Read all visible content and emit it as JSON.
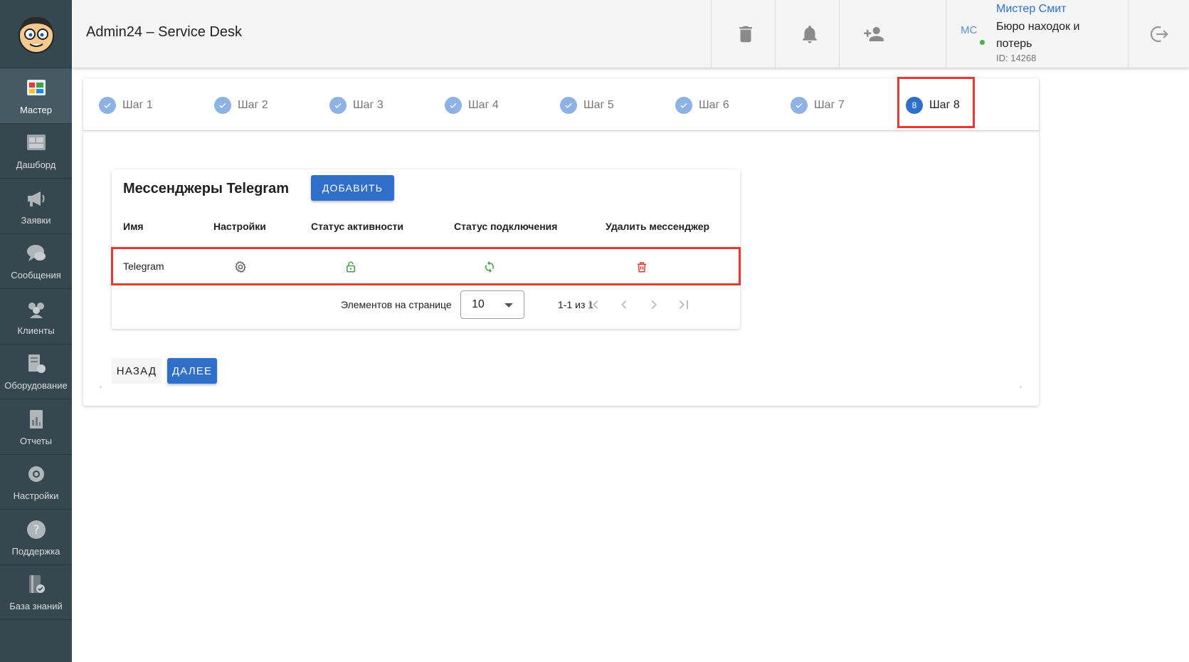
{
  "app": {
    "title": "Admin24 – Service Desk"
  },
  "sidebar": {
    "items": [
      {
        "label": "Мастер",
        "icon": "wizard-icon",
        "active": true
      },
      {
        "label": "Дашборд",
        "icon": "dashboard-icon"
      },
      {
        "label": "Заявки",
        "icon": "megaphone-icon"
      },
      {
        "label": "Сообщения",
        "icon": "chat-icon"
      },
      {
        "label": "Клиенты",
        "icon": "clients-icon"
      },
      {
        "label": "Оборудование",
        "icon": "equipment-icon"
      },
      {
        "label": "Отчеты",
        "icon": "reports-icon"
      },
      {
        "label": "Настройки",
        "icon": "gear-icon"
      },
      {
        "label": "Поддержка",
        "icon": "help-icon"
      },
      {
        "label": "База знаний",
        "icon": "knowledge-base-icon"
      }
    ]
  },
  "header": {
    "user": {
      "initials": "МС",
      "name": "Мистер Смит",
      "org": "Бюро находок и потерь",
      "id": "ID: 14268"
    }
  },
  "steps": [
    {
      "label": "Шаг 1",
      "done": true
    },
    {
      "label": "Шаг 2",
      "done": true
    },
    {
      "label": "Шаг 3",
      "done": true
    },
    {
      "label": "Шаг 4",
      "done": true
    },
    {
      "label": "Шаг 5",
      "done": true
    },
    {
      "label": "Шаг 6",
      "done": true
    },
    {
      "label": "Шаг 7",
      "done": true
    },
    {
      "label": "Шаг 8",
      "number": "8",
      "current": true
    }
  ],
  "messengers": {
    "title": "Мессенджеры Telegram",
    "add_label": "ДОБАВИТЬ",
    "columns": [
      "Имя",
      "Настройки",
      "Статус активности",
      "Статус подключения",
      "Удалить мессенджер"
    ],
    "rows": [
      {
        "name": "Telegram"
      }
    ],
    "pager": {
      "per_page_label": "Элементов на странице",
      "per_page_value": "10",
      "range": "1-1 из 1"
    }
  },
  "nav": {
    "back_label": "НАЗАД",
    "next_label": "ДАЛЕЕ"
  },
  "colors": {
    "accent": "#2f6fc9",
    "highlight": "#e53935",
    "sidebar": "#37474f",
    "success": "#43a047",
    "danger": "#e53935"
  }
}
